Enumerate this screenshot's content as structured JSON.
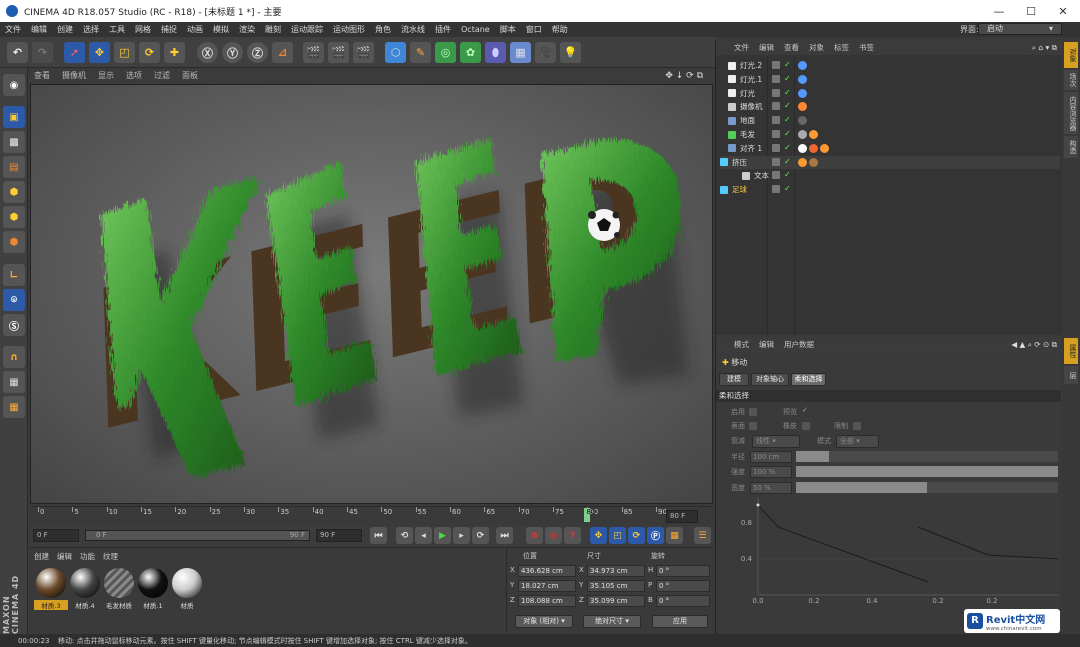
{
  "window": {
    "title": "CINEMA 4D R18.057 Studio (RC - R18) - [未标题 1 *] - 主要",
    "min": "—",
    "max": "☐",
    "close": "✕"
  },
  "menu": [
    "文件",
    "编辑",
    "创建",
    "选择",
    "工具",
    "网格",
    "捕捉",
    "动画",
    "模拟",
    "渲染",
    "雕刻",
    "运动跟踪",
    "运动图形",
    "角色",
    "流水线",
    "插件",
    "Octane",
    "脚本",
    "窗口",
    "帮助"
  ],
  "layout": {
    "label": "界面:",
    "value": "启动"
  },
  "viewport_menu": [
    "查看",
    "摄像机",
    "显示",
    "选项",
    "过滤",
    "面板"
  ],
  "viewport": {
    "word": "KEEP"
  },
  "timeline": {
    "ticks": [
      "0",
      "5",
      "10",
      "15",
      "20",
      "25",
      "30",
      "35",
      "40",
      "45",
      "50",
      "55",
      "60",
      "65",
      "70",
      "75",
      "80",
      "85",
      "90"
    ],
    "current": "80",
    "end_field": "80 F",
    "playhead_frac": 0.8889
  },
  "transport": {
    "start": "0 F",
    "slider_start": "0 F",
    "slider_end": "90 F",
    "end": "90 F"
  },
  "material_manager": {
    "menu": [
      "创建",
      "编辑",
      "功能",
      "纹理"
    ],
    "materials": [
      {
        "name": "材质.3",
        "color": "#6b4a2a"
      },
      {
        "name": "材质.4",
        "color": "#444"
      },
      {
        "name": "毛发材质",
        "color": "#777"
      },
      {
        "name": "材质.1",
        "color": "#111"
      },
      {
        "name": "材质",
        "color": "#ccc"
      }
    ]
  },
  "coordinates": {
    "headers": [
      "位置",
      "尺寸",
      "旋转"
    ],
    "rows": [
      {
        "axis": "X",
        "pos": "436.628 cm",
        "size_axis": "X",
        "size": "34.973 cm",
        "rot_axis": "H",
        "rot": "0 °"
      },
      {
        "axis": "Y",
        "pos": "18.027 cm",
        "size_axis": "Y",
        "size": "35.105 cm",
        "rot_axis": "P",
        "rot": "0 °"
      },
      {
        "axis": "Z",
        "pos": "108.088 cm",
        "size_axis": "Z",
        "size": "35.099 cm",
        "rot_axis": "B",
        "rot": "0 °"
      }
    ],
    "mode": "对象 (相对)",
    "size_mode": "绝对尺寸",
    "apply": "应用"
  },
  "object_manager": {
    "menu": [
      "文件",
      "编辑",
      "查看",
      "对象",
      "标签",
      "书签"
    ],
    "objects": [
      {
        "name": "灯光.2",
        "color": "#eee"
      },
      {
        "name": "灯光.1",
        "color": "#eee"
      },
      {
        "name": "灯光",
        "color": "#eee"
      },
      {
        "name": "摄像机",
        "color": "#ccc"
      },
      {
        "name": "地面",
        "color": "#79c"
      },
      {
        "name": "毛发",
        "color": "#5c5"
      },
      {
        "name": "对齐 1",
        "color": "#79c"
      },
      {
        "name": "挤压",
        "color": "#5cf"
      },
      {
        "name": "文本",
        "color": "#ccc"
      },
      {
        "name": "足球",
        "color": "#5cf"
      }
    ]
  },
  "attribute_manager": {
    "menu": [
      "模式",
      "编辑",
      "用户数据"
    ],
    "tool": "移动",
    "tabs": [
      "建模",
      "对象轴心",
      "柔和选择"
    ],
    "section": "柔和选择",
    "labels": {
      "enable": "启用",
      "preview": "预览",
      "surface": "表面",
      "rubber": "橡皮",
      "restrict": "限制",
      "falloff_mode": "衰减",
      "falloff_value": "线性",
      "mode": "模式",
      "mode_value": "全部",
      "radius": "半径",
      "radius_value": "100 cm",
      "strength": "强度",
      "strength_value": "100 %",
      "width": "宽度",
      "width_value": "50 %"
    },
    "levels": {
      "radius": 0.125,
      "strength": 1.0,
      "width": 0.5
    },
    "graph": {
      "y_labels": [
        "0.8",
        "0.4"
      ],
      "x_labels": [
        "0.0",
        "0.2",
        "0.4",
        "0.2",
        "0.2"
      ]
    }
  },
  "side_tabs": [
    "对象",
    "场次",
    "内容浏览器",
    "构造",
    "属性",
    "层"
  ],
  "status": {
    "time": "00:00:23",
    "message": "移动: 点击并拖动鼠标移动元素。按住 SHIFT 键量化移动; 节点编辑模式时按住 SHIFT 键增加选择对象; 按住 CTRL 键减少选择对象。"
  },
  "watermark": {
    "name": "Revit中文网",
    "url": "www.chinarevit.com"
  },
  "brand": "MAXON CINEMA 4D"
}
